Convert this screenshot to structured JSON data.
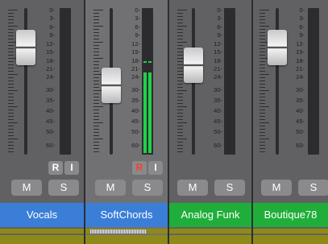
{
  "scale_labels": [
    "0",
    "3",
    "6",
    "9",
    "12",
    "15",
    "18",
    "21",
    "24",
    "30",
    "35",
    "40",
    "45",
    "50",
    "60"
  ],
  "channels": [
    {
      "name": "Vocals",
      "color": "#3a7ed8",
      "show_ri": true,
      "r_label": "R",
      "i_label": "I",
      "r_active": false,
      "m_label": "M",
      "s_label": "S",
      "meter_level": 0
    },
    {
      "name": "SoftChords",
      "color": "#3a7ed8",
      "show_ri": true,
      "r_label": "R",
      "i_label": "I",
      "r_active": true,
      "m_label": "M",
      "s_label": "S",
      "meter_level": 0.58
    },
    {
      "name": "Analog Funk",
      "color": "#1fae3a",
      "show_ri": false,
      "m_label": "M",
      "s_label": "S",
      "meter_level": 0
    },
    {
      "name": "Boutique78",
      "color": "#1fae3a",
      "show_ri": false,
      "m_label": "M",
      "s_label": "S",
      "meter_level": 0
    }
  ]
}
